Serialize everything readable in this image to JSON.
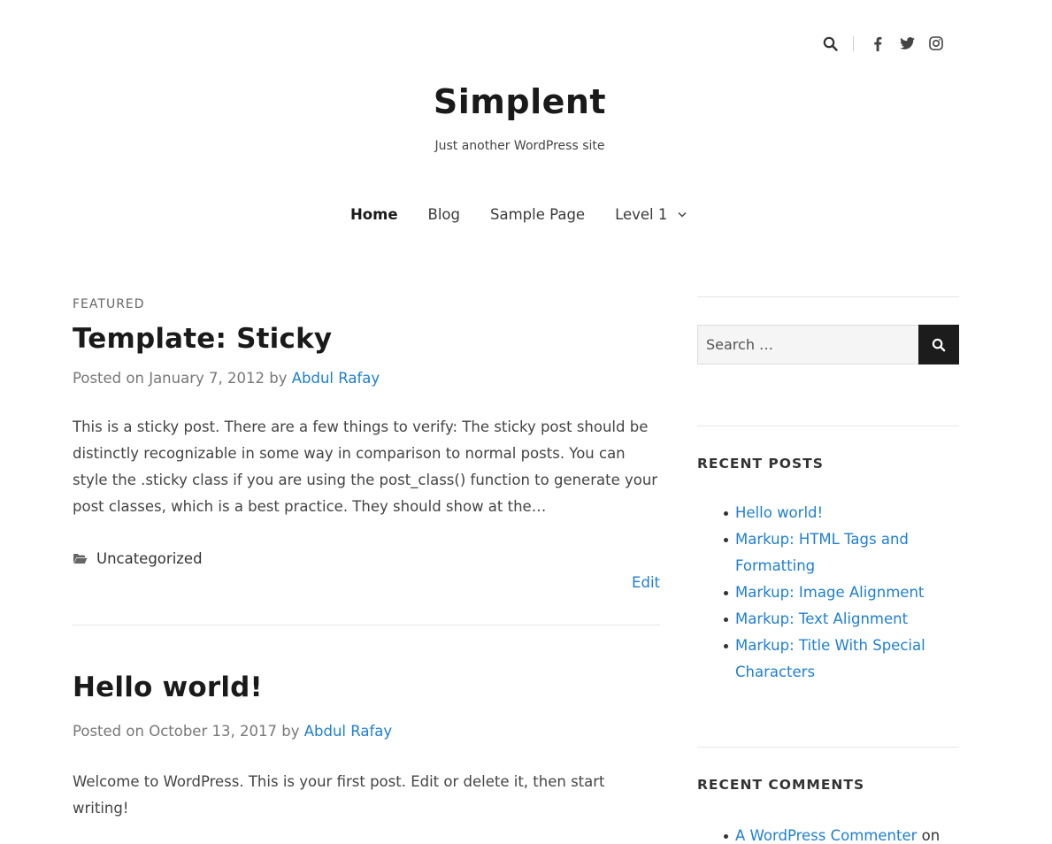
{
  "header": {
    "icons": [
      "search-icon",
      "facebook-icon",
      "twitter-icon",
      "instagram-icon"
    ],
    "site_title": "Simplent",
    "site_description": "Just another WordPress site"
  },
  "nav": {
    "items": [
      "Home",
      "Blog",
      "Sample Page",
      "Level 1"
    ],
    "active": "Home"
  },
  "posts": [
    {
      "label": "FEATURED",
      "title": "Template: Sticky",
      "meta_prefix": "Posted on",
      "date": "January 7, 2012",
      "by": "by",
      "author": "Abdul Rafay",
      "excerpt": "This is a sticky post. There are a few things to verify: The sticky post should be distinctly recognizable in some way in comparison to normal posts. You can style the .sticky class if you are using the post_class() function to generate your post classes, which is a best practice. They should show at the…",
      "category": "Uncategorized",
      "edit_label": "Edit"
    },
    {
      "title": "Hello world!",
      "meta_prefix": "Posted on",
      "date": "October 13, 2017",
      "by": "by",
      "author": "Abdul Rafay",
      "excerpt": "Welcome to WordPress. This is your first post. Edit or delete it, then start writing!"
    }
  ],
  "sidebar": {
    "search_placeholder": "Search …",
    "recent_posts_title": "RECENT POSTS",
    "recent_posts": [
      "Hello world!",
      "Markup: HTML Tags and Formatting",
      "Markup: Image Alignment",
      "Markup: Text Alignment",
      "Markup: Title With Special Characters"
    ],
    "recent_comments_title": "RECENT COMMENTS",
    "recent_comments": [
      {
        "author": "A WordPress Commenter",
        "on": "on"
      }
    ]
  },
  "colors": {
    "link": "#1e7fd1",
    "text": "#333333",
    "button_bg": "#1c1c1c"
  }
}
